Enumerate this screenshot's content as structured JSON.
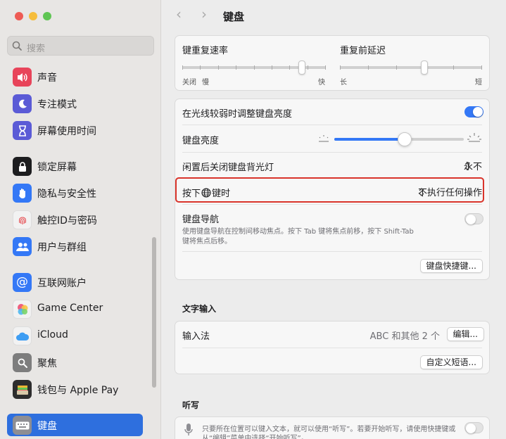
{
  "window": {
    "lights": {
      "close": "#ee5b54",
      "minimize": "#f6bd3b",
      "maximize": "#5fc553"
    }
  },
  "search": {
    "placeholder": "搜索",
    "icon": "magnifier-icon"
  },
  "sidebar": {
    "items": [
      {
        "label": "声音",
        "icon": "speaker-icon",
        "color": "#e8445a"
      },
      {
        "label": "专注模式",
        "icon": "moon-icon",
        "color": "#5b5bd6"
      },
      {
        "label": "屏幕使用时间",
        "icon": "hourglass-icon",
        "color": "#5b5bd6"
      },
      {
        "label": "锁定屏幕",
        "icon": "lock-icon",
        "color": "#1d1d1f"
      },
      {
        "label": "隐私与安全性",
        "icon": "hand-icon",
        "color": "#3478f6"
      },
      {
        "label": "触控ID与密码",
        "icon": "fingerprint-icon",
        "color": "#f2f2f2"
      },
      {
        "label": "用户与群组",
        "icon": "users-icon",
        "color": "#3478f6"
      },
      {
        "label": "互联网账户",
        "icon": "at-icon",
        "color": "#3478f6"
      },
      {
        "label": "Game Center",
        "icon": "game-center-icon",
        "color": "#f2f2f2"
      },
      {
        "label": "iCloud",
        "icon": "cloud-icon",
        "color": "#f2f2f2"
      },
      {
        "label": "聚焦",
        "icon": "spotlight-icon",
        "color": "#7d7d7d"
      },
      {
        "label": "钱包与 Apple Pay",
        "icon": "wallet-icon",
        "color": "#2d2d2d"
      },
      {
        "label": "键盘",
        "icon": "keyboard-icon",
        "color": "#8e8e93",
        "selected": true
      }
    ]
  },
  "header": {
    "title": "键盘",
    "back": "‹",
    "forward": "›"
  },
  "repeat": {
    "rate_label": "键重复速率",
    "rate_off": "关闭",
    "rate_slow": "慢",
    "rate_fast": "快",
    "rate_level": 0.85,
    "delay_label": "重复前延迟",
    "delay_long": "长",
    "delay_short": "短",
    "delay_level": 0.6
  },
  "lighting": {
    "adjust_label": "在光线较弱时调整键盘亮度",
    "adjust_on": true,
    "brightness_label": "键盘亮度",
    "brightness_level": 0.55,
    "idle_label": "闲置后关闭键盘背光灯",
    "idle_value": "永不"
  },
  "globe": {
    "label_pre": "按下",
    "label_post": "键时",
    "value": "不执行任何操作",
    "highlight_color": "#d9342b"
  },
  "nav": {
    "label": "键盘导航",
    "desc1": "使用键盘导航在控制间移动焦点。按下 Tab 键将焦点前移，按下 Shift-Tab",
    "desc2": "键将焦点后移。",
    "on": false,
    "shortcuts_button": "键盘快捷键..."
  },
  "text_input": {
    "section": "文字输入",
    "input_label": "输入法",
    "input_value": "ABC 和其他 2 个",
    "edit_button": "编辑...",
    "replace_button": "自定义短语..."
  },
  "dictation": {
    "section": "听写",
    "desc1": "只要所在位置可以键入文本，就可以使用“听写”。若要开始听写，请使用快捷键或",
    "desc2": "从“编辑”菜单中选择“开始听写”。",
    "on": false
  },
  "colors": {
    "accent": "#2e6fde",
    "toggle_on": "#3478f6"
  }
}
